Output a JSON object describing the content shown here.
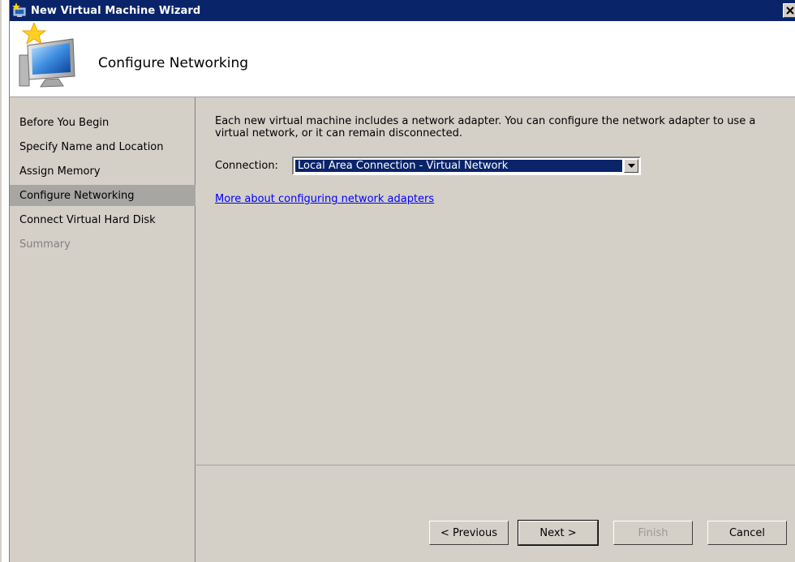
{
  "window": {
    "title": "New Virtual Machine Wizard"
  },
  "header": {
    "page_title": "Configure Networking"
  },
  "sidebar": {
    "steps": [
      {
        "label": "Before You Begin",
        "state": "normal"
      },
      {
        "label": "Specify Name and Location",
        "state": "normal"
      },
      {
        "label": "Assign Memory",
        "state": "normal"
      },
      {
        "label": "Configure Networking",
        "state": "active"
      },
      {
        "label": "Connect Virtual Hard Disk",
        "state": "normal"
      },
      {
        "label": "Summary",
        "state": "disabled"
      }
    ]
  },
  "content": {
    "description": "Each new virtual machine includes a network adapter. You can configure the network adapter to use a virtual network, or it can remain disconnected.",
    "connection_label": "Connection:",
    "connection_value": "Local Area Connection - Virtual Network",
    "help_link": "More about configuring network adapters"
  },
  "buttons": {
    "previous": "< Previous",
    "next": "Next >",
    "finish": "Finish",
    "cancel": "Cancel"
  },
  "colors": {
    "titlebar": "#0a246a",
    "face": "#d4d0c8",
    "selected_step": "#a7a6a3",
    "link": "#0000ff"
  },
  "icons": {
    "app": "virtual-machine-icon",
    "wizard": "monitor-star-icon",
    "close": "close-icon",
    "dropdown": "chevron-down-icon"
  }
}
